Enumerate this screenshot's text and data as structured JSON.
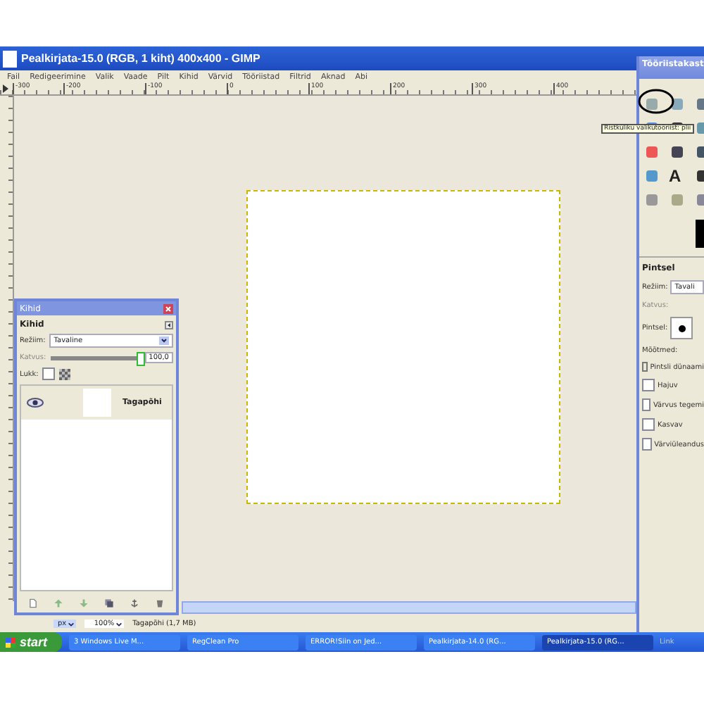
{
  "window": {
    "title": "Pealkirjata-15.0 (RGB, 1 kiht) 400x400 - GIMP"
  },
  "menu": [
    "Fail",
    "Redigeerimine",
    "Valik",
    "Vaade",
    "Pilt",
    "Kihid",
    "Värvid",
    "Tööriistad",
    "Filtrid",
    "Aknad",
    "Abi"
  ],
  "ruler": [
    "-300",
    "-200",
    "-100",
    "0",
    "100",
    "200",
    "300",
    "400"
  ],
  "status_bar": {
    "unit": "px",
    "zoom": "100%",
    "info": "Tagapõhi (1,7 MB)"
  },
  "layers_dialog": {
    "title": "Kihid",
    "header": "Kihid",
    "mode_label": "Režiim:",
    "mode": "Tavaline",
    "opacity_label": "Katvus:",
    "opacity": "100,0",
    "level": 1,
    "lock_label": "Lukk:",
    "lock_checked": false,
    "layers": [
      {
        "name": "Tagapõhi",
        "visible": true,
        "selected": false
      }
    ]
  },
  "toolbox": {
    "title": "Tööriistakast",
    "tooltip": "Ristküliku valikutööriist: plii",
    "text_tool_glyph": "A",
    "section": "Pintsel",
    "mode_label": "Režiim:",
    "mode": "Tavali",
    "opacity_label": "Katvus:",
    "brush_label": "Pintsel:",
    "size_label": "Mõõtmed:",
    "dynamics": "Pintsli dünaami",
    "options": [
      {
        "label": "Hajuv",
        "checked": false
      },
      {
        "label": "Värvus tegemi",
        "checked": false
      },
      {
        "label": "Kasvav",
        "checked": false
      },
      {
        "label": "Värviüleandus",
        "checked": false
      }
    ]
  },
  "taskbar": {
    "start": "start",
    "items": [
      {
        "label": "3 Windows Live M...",
        "selected": false
      },
      {
        "label": "RegClean Pro",
        "selected": false
      },
      {
        "label": "ERROR!Siin on Jed...",
        "selected": false
      },
      {
        "label": "Pealkirjata-14.0 (RG...",
        "selected": false
      },
      {
        "label": "Pealkirjata-15.0 (RG...",
        "selected": true
      }
    ],
    "links": "Link"
  }
}
